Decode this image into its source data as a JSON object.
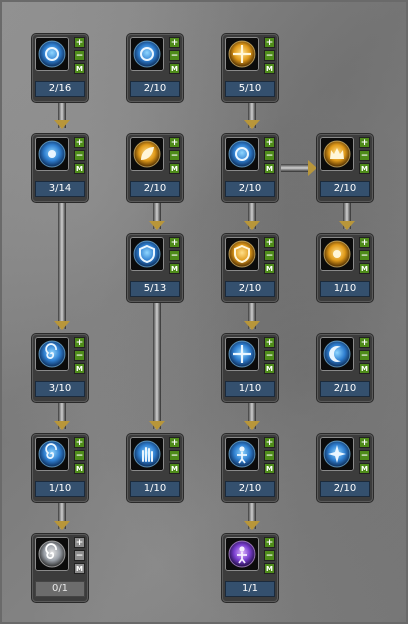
{
  "skill_tree": {
    "nodes": [
      {
        "id": "r1c1",
        "icon": "sun-ring-icon",
        "level": "2/16",
        "theme": "blue"
      },
      {
        "id": "r1c2",
        "icon": "figure-ring-icon",
        "level": "2/10",
        "theme": "blue"
      },
      {
        "id": "r1c3",
        "icon": "golden-cross-icon",
        "level": "5/10",
        "theme": "gold"
      },
      {
        "id": "r2c1",
        "icon": "blue-orb-icon",
        "level": "3/14",
        "theme": "blue"
      },
      {
        "id": "r2c2",
        "icon": "golden-leaf-icon",
        "level": "2/10",
        "theme": "gold"
      },
      {
        "id": "r2c3",
        "icon": "blue-ring-icon",
        "level": "2/10",
        "theme": "blue"
      },
      {
        "id": "r2c4",
        "icon": "golden-crown-icon",
        "level": "2/10",
        "theme": "gold"
      },
      {
        "id": "r3c2",
        "icon": "blue-shield-icon",
        "level": "5/13",
        "theme": "blue"
      },
      {
        "id": "r3c3",
        "icon": "golden-shield-icon",
        "level": "2/10",
        "theme": "gold"
      },
      {
        "id": "r3c4",
        "icon": "golden-orb-icon",
        "level": "1/10",
        "theme": "gold"
      },
      {
        "id": "r5c1",
        "icon": "blue-spiral-icon",
        "level": "3/10",
        "theme": "blue"
      },
      {
        "id": "r5c3",
        "icon": "blue-crosshair-icon",
        "level": "1/10",
        "theme": "blue"
      },
      {
        "id": "r5c4",
        "icon": "blue-crescent-icon",
        "level": "2/10",
        "theme": "blue"
      },
      {
        "id": "r6c1",
        "icon": "blue-vortex-icon",
        "level": "1/10",
        "theme": "blue"
      },
      {
        "id": "r6c2",
        "icon": "blue-hand-icon",
        "level": "1/10",
        "theme": "blue"
      },
      {
        "id": "r6c3",
        "icon": "blue-figure-icon",
        "level": "2/10",
        "theme": "blue"
      },
      {
        "id": "r6c4",
        "icon": "blue-star-icon",
        "level": "2/10",
        "theme": "blue"
      },
      {
        "id": "r7c1",
        "icon": "white-swirl-icon",
        "level": "0/1",
        "theme": "white",
        "locked": true
      },
      {
        "id": "r7c3",
        "icon": "purple-figure-icon",
        "level": "1/1",
        "theme": "purple"
      }
    ],
    "buttons": {
      "plus": "+",
      "minus": "−",
      "max": "M"
    }
  },
  "colors": {
    "level_bar": "#34506e",
    "level_bar_locked": "#6c6c6c",
    "button_active": "#4f8c1a",
    "button_inactive": "#8d8d8d",
    "arrow": "#b8963a"
  }
}
